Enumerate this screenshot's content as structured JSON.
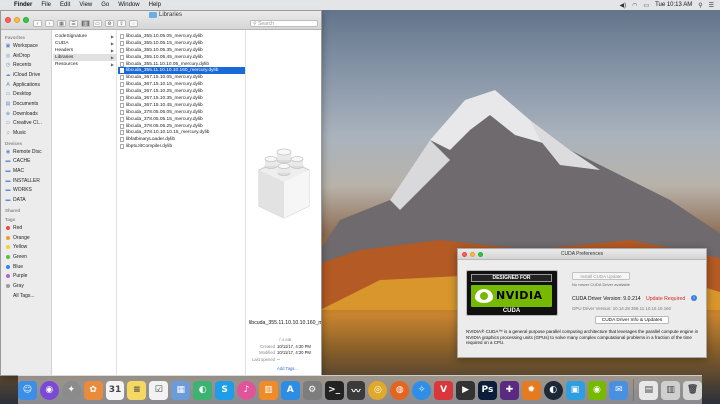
{
  "menubar": {
    "items": [
      "Finder",
      "File",
      "Edit",
      "View",
      "Go",
      "Window",
      "Help"
    ],
    "clock": "Tue 10:13 AM"
  },
  "finder": {
    "title": "Libraries",
    "search_placeholder": "Search",
    "sidebar": {
      "favorites_head": "Favorites",
      "favorites": [
        {
          "icon": "workspace-icon",
          "glyph": "▣",
          "label": "Workspace"
        },
        {
          "icon": "airdrop-icon",
          "glyph": "◎",
          "label": "AirDrop"
        },
        {
          "icon": "recents-icon",
          "glyph": "◷",
          "label": "Recents"
        },
        {
          "icon": "icloud-icon",
          "glyph": "☁",
          "label": "iCloud Drive"
        },
        {
          "icon": "applications-icon",
          "glyph": "A",
          "label": "Applications"
        },
        {
          "icon": "desktop-icon",
          "glyph": "▭",
          "label": "Desktop"
        },
        {
          "icon": "documents-icon",
          "glyph": "▤",
          "label": "Documents"
        },
        {
          "icon": "downloads-icon",
          "glyph": "⊕",
          "label": "Downloads"
        },
        {
          "icon": "folder-icon",
          "glyph": "▭",
          "label": "Creative Cl..."
        },
        {
          "icon": "music-icon",
          "glyph": "♫",
          "label": "Music"
        }
      ],
      "devices_head": "Devices",
      "devices": [
        {
          "icon": "remote-disc-icon",
          "glyph": "◉",
          "label": "Remote Disc"
        },
        {
          "icon": "drive-icon",
          "glyph": "▬",
          "label": "CACHE"
        },
        {
          "icon": "drive-icon",
          "glyph": "▬",
          "label": "MAC"
        },
        {
          "icon": "drive-icon",
          "glyph": "▬",
          "label": "INSTALLER"
        },
        {
          "icon": "drive-icon",
          "glyph": "▬",
          "label": "WORKS"
        },
        {
          "icon": "drive-icon",
          "glyph": "▬",
          "label": "DATA"
        }
      ],
      "shared_head": "Shared",
      "tags_head": "Tags",
      "tags": [
        {
          "label": "Red",
          "color": "#f0463b"
        },
        {
          "label": "Orange",
          "color": "#f79a2b"
        },
        {
          "label": "Yellow",
          "color": "#f6cf35"
        },
        {
          "label": "Green",
          "color": "#58c23d"
        },
        {
          "label": "Blue",
          "color": "#2f86f0"
        },
        {
          "label": "Purple",
          "color": "#b162d6"
        },
        {
          "label": "Gray",
          "color": "#9a9a9a"
        },
        {
          "label": "All Tags...",
          "color": ""
        }
      ]
    },
    "column1": [
      {
        "label": "CodeSignature",
        "arrow": true,
        "selected": false
      },
      {
        "label": "CUDA",
        "arrow": true,
        "selected": false
      },
      {
        "label": "Headers",
        "arrow": true,
        "selected": false
      },
      {
        "label": "Libraries",
        "arrow": true,
        "selected": true
      },
      {
        "label": "Resources",
        "arrow": true,
        "selected": false
      }
    ],
    "column2": [
      {
        "label": "libcuda_355.10.05.05_mercury.dylib",
        "selected": false
      },
      {
        "label": "libcuda_355.10.05.15_mercury.dylib",
        "selected": false
      },
      {
        "label": "libcuda_355.10.05.35_mercury.dylib",
        "selected": false
      },
      {
        "label": "libcuda_355.10.05.45_mercury.dylib",
        "selected": false
      },
      {
        "label": "libcuda_355.11.10.10.05_mercury.dylib",
        "selected": false
      },
      {
        "label": "libcuda_355.11.10.10.10.160_mercury.dylib",
        "selected": true
      },
      {
        "label": "libcuda_367.15.10.05_mercury.dylib",
        "selected": false
      },
      {
        "label": "libcuda_367.15.10.15_mercury.dylib",
        "selected": false
      },
      {
        "label": "libcuda_367.15.10.25_mercury.dylib",
        "selected": false
      },
      {
        "label": "libcuda_367.15.10.35_mercury.dylib",
        "selected": false
      },
      {
        "label": "libcuda_367.15.10.45_mercury.dylib",
        "selected": false
      },
      {
        "label": "libcuda_378.05.05.05_mercury.dylib",
        "selected": false
      },
      {
        "label": "libcuda_378.05.05.15_mercury.dylib",
        "selected": false
      },
      {
        "label": "libcuda_378.05.05.25_mercury.dylib",
        "selected": false
      },
      {
        "label": "libcuda_378.10.10.10.15_mercury.dylib",
        "selected": false
      },
      {
        "label": "libfatbinaryLoader.dylib",
        "selected": false
      },
      {
        "label": "libptxJitCompiler.dylib",
        "selected": false
      }
    ],
    "preview": {
      "name": "libcuda_355.11.10.10.10.160_mercury.dylib",
      "size": "7.4 MB",
      "meta": [
        {
          "key": "Created",
          "value": "10/11/17, 4:30 PM"
        },
        {
          "key": "Modified",
          "value": "10/11/17, 4:30 PM"
        },
        {
          "key": "Last opened",
          "value": "--"
        }
      ],
      "add_tags": "Add Tags..."
    }
  },
  "cuda_prefs": {
    "title": "CUDA Preferences",
    "badge_top": "DESIGNED FOR",
    "badge_brand": "NVIDIA",
    "badge_cuda": "CUDA",
    "install_button": "Install CUDA Update",
    "no_update": "No newer CUDA Driver available",
    "driver_version": "CUDA Driver Version: 9.0.214",
    "update_required": "Update Required",
    "gpu_driver_version": "GPU Driver Version: 10.14.28 355.11.10.10.10.160",
    "info_button": "CUDA Driver Info & Updates",
    "description": "NVIDIA® CUDA™ is a general purpose parallel computing architecture that leverages the parallel compute engine in NVIDIA graphics processing units (GPUs) to solve many complex computational problems in a fraction of the time required on a CPU."
  },
  "dock": {
    "icons": [
      {
        "name": "finder-icon",
        "glyph": "☺",
        "color": "#3d8ee6",
        "round": false
      },
      {
        "name": "siri-icon",
        "glyph": "◉",
        "color": "#7a4ad6",
        "round": true
      },
      {
        "name": "launchpad-icon",
        "glyph": "✦",
        "color": "#8b8b8b",
        "round": true
      },
      {
        "name": "photos-icon",
        "glyph": "✿",
        "color": "#e98a3c",
        "round": false
      },
      {
        "name": "calendar-icon",
        "glyph": "31",
        "color": "#f4f4f4",
        "round": false
      },
      {
        "name": "notes-icon",
        "glyph": "≡",
        "color": "#f5d764",
        "round": false
      },
      {
        "name": "reminders-icon",
        "glyph": "☑",
        "color": "#f2f2f2",
        "round": false
      },
      {
        "name": "preview-icon",
        "glyph": "▦",
        "color": "#6b9bd8",
        "round": false
      },
      {
        "name": "facetime-icon",
        "glyph": "◐",
        "color": "#3cb371",
        "round": false
      },
      {
        "name": "skype-icon",
        "glyph": "S",
        "color": "#1e9ee8",
        "round": false
      },
      {
        "name": "itunes-icon",
        "glyph": "♪",
        "color": "#e0559a",
        "round": true
      },
      {
        "name": "ibooks-icon",
        "glyph": "▥",
        "color": "#f08c27",
        "round": false
      },
      {
        "name": "app-store-icon",
        "glyph": "A",
        "color": "#2d8de4",
        "round": false
      },
      {
        "name": "system-preferences-icon",
        "glyph": "⚙",
        "color": "#7d7d7d",
        "round": false
      },
      {
        "name": "terminal-icon",
        "glyph": ">_",
        "color": "#222222",
        "round": false
      },
      {
        "name": "activity-monitor-icon",
        "glyph": "〰",
        "color": "#3a3a3a",
        "round": false
      },
      {
        "name": "chrome-icon",
        "glyph": "◎",
        "color": "#e0a92a",
        "round": true
      },
      {
        "name": "firefox-icon",
        "glyph": "◍",
        "color": "#e5641f",
        "round": true
      },
      {
        "name": "safari-icon",
        "glyph": "✧",
        "color": "#2f8fe8",
        "round": true
      },
      {
        "name": "vivaldi-icon",
        "glyph": "V",
        "color": "#d9373b",
        "round": false
      },
      {
        "name": "final-cut-icon",
        "glyph": "▶",
        "color": "#333333",
        "round": false
      },
      {
        "name": "photoshop-icon",
        "glyph": "Ps",
        "color": "#0b1d3a",
        "round": false
      },
      {
        "name": "premiere-icon",
        "glyph": "✚",
        "color": "#5a2a80",
        "round": false
      },
      {
        "name": "flstudio-icon",
        "glyph": "✹",
        "color": "#e57a1f",
        "round": false
      },
      {
        "name": "steam-icon",
        "glyph": "◐",
        "color": "#1b2838",
        "round": true
      },
      {
        "name": "media-icon",
        "glyph": "▣",
        "color": "#2f9ee0",
        "round": false
      },
      {
        "name": "cuda-icon",
        "glyph": "◉",
        "color": "#76b900",
        "round": false
      },
      {
        "name": "mail-icon",
        "glyph": "✉",
        "color": "#4a90e2",
        "round": false
      },
      {
        "name": "document-icon",
        "glyph": "▤",
        "color": "#e8e8e8",
        "round": false
      },
      {
        "name": "downloads-stack-icon",
        "glyph": "▥",
        "color": "#cfcfcf",
        "round": false
      },
      {
        "name": "trash-icon",
        "glyph": "🗑",
        "color": "#d6d6d6",
        "round": false
      }
    ]
  }
}
